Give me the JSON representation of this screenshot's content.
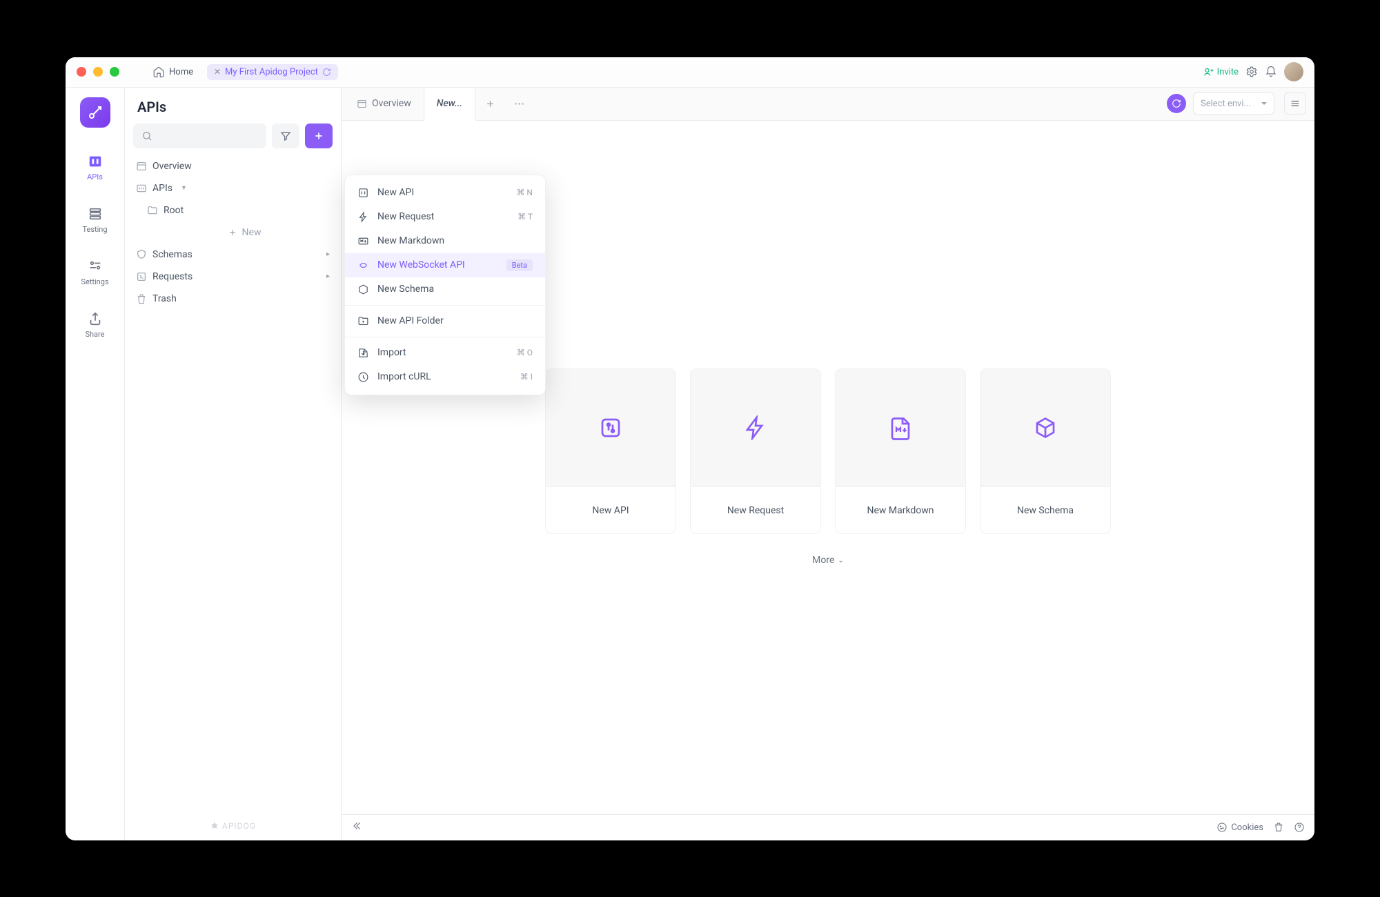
{
  "titlebar": {
    "home": "Home",
    "project_tab": "My First Apidog Project",
    "invite": "Invite"
  },
  "rail": {
    "apis": "APIs",
    "testing": "Testing",
    "settings": "Settings",
    "share": "Share"
  },
  "sidebar": {
    "title": "APIs",
    "overview": "Overview",
    "apis": "APIs",
    "root": "Root",
    "new": "New",
    "schemas": "Schemas",
    "requests": "Requests",
    "trash": "Trash",
    "brand": "APIDOG"
  },
  "tabs": {
    "overview": "Overview",
    "new": "New...",
    "env_placeholder": "Select envi..."
  },
  "dropdown": {
    "new_api": "New API",
    "new_api_kb": "⌘ N",
    "new_request": "New Request",
    "new_request_kb": "⌘ T",
    "new_markdown": "New Markdown",
    "new_websocket": "New WebSocket API",
    "beta": "Beta",
    "new_schema": "New Schema",
    "new_folder": "New API Folder",
    "import": "Import",
    "import_kb": "⌘ O",
    "import_curl": "Import cURL",
    "import_curl_kb": "⌘ I"
  },
  "cards": {
    "new_api": "New API",
    "new_request": "New Request",
    "new_markdown": "New Markdown",
    "new_schema": "New Schema",
    "more": "More"
  },
  "footer": {
    "cookies": "Cookies"
  }
}
